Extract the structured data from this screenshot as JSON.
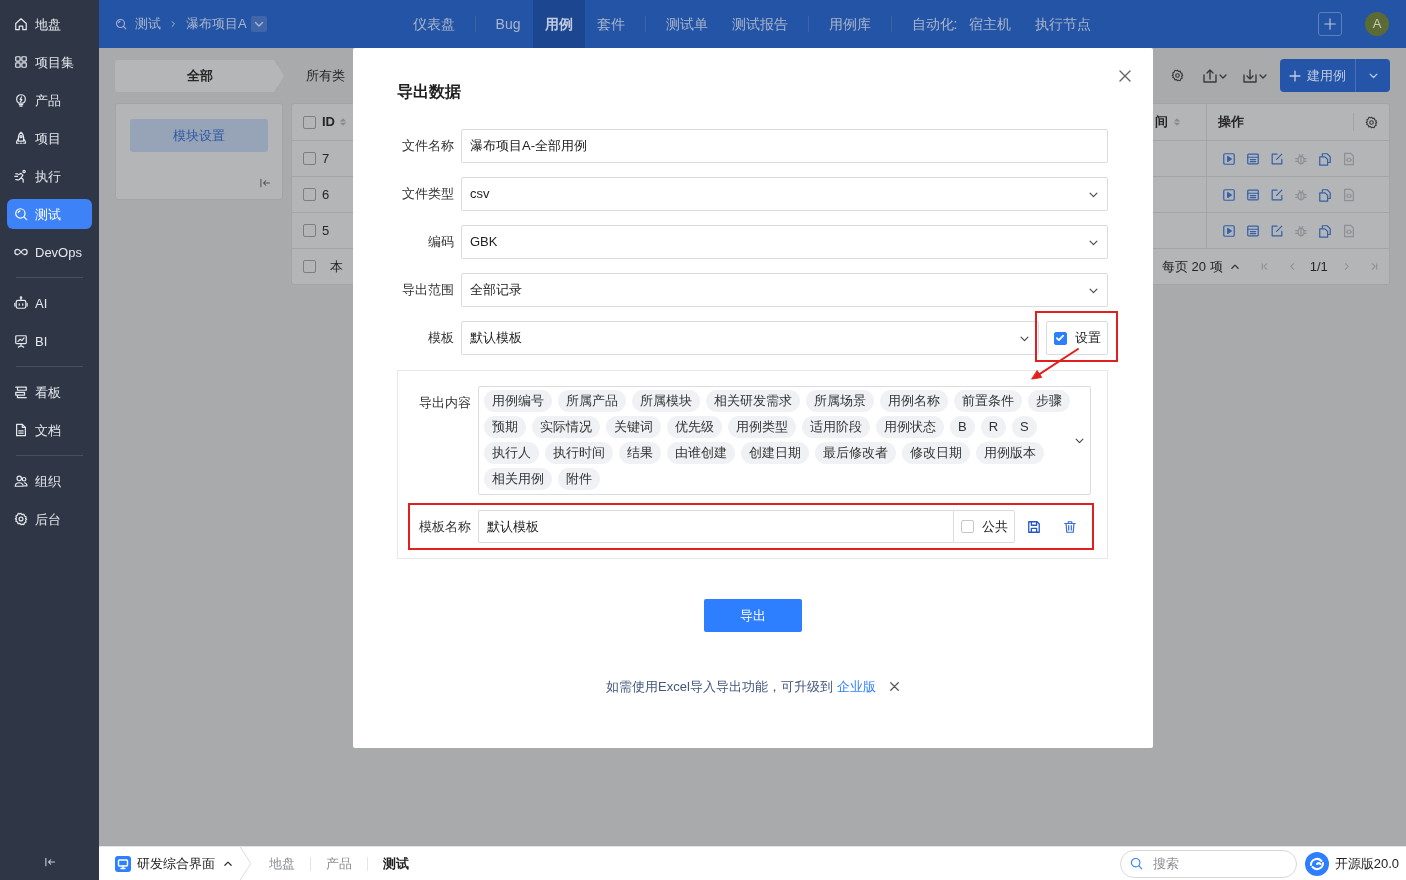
{
  "sidebar": {
    "groups": [
      {
        "items": [
          {
            "label": "地盘",
            "selected": false
          },
          {
            "label": "项目集",
            "selected": false
          },
          {
            "label": "产品",
            "selected": false
          },
          {
            "label": "项目",
            "selected": false
          },
          {
            "label": "执行",
            "selected": false
          },
          {
            "label": "测试",
            "selected": true
          },
          {
            "label": "DevOps",
            "selected": false
          }
        ]
      },
      {
        "items": [
          {
            "label": "AI",
            "selected": false
          },
          {
            "label": "BI",
            "selected": false
          }
        ]
      },
      {
        "items": [
          {
            "label": "看板",
            "selected": false
          },
          {
            "label": "文档",
            "selected": false
          }
        ]
      },
      {
        "items": [
          {
            "label": "组织",
            "selected": false
          },
          {
            "label": "后台",
            "selected": false
          }
        ]
      }
    ]
  },
  "top_bar": {
    "module": "测试",
    "project": "瀑布项目A",
    "menu": [
      {
        "items": [
          {
            "label": "仪表盘",
            "selected": false
          }
        ]
      },
      {
        "items": [
          {
            "label": "Bug",
            "selected": false
          },
          {
            "label": "用例",
            "selected": true
          },
          {
            "label": "套件",
            "selected": false
          }
        ]
      },
      {
        "items": [
          {
            "label": "测试单",
            "selected": false
          },
          {
            "label": "测试报告",
            "selected": false
          }
        ]
      },
      {
        "items": [
          {
            "label": "用例库",
            "selected": false
          }
        ]
      },
      {
        "label": "自动化:",
        "items": [
          {
            "label": "宿主机",
            "selected": false
          },
          {
            "label": "执行节点",
            "selected": false
          }
        ]
      }
    ],
    "avatar": "A"
  },
  "filter_bar": {
    "tabs": [
      {
        "label": "全部",
        "selected": true
      },
      {
        "label": "所有类",
        "selected": false
      }
    ]
  },
  "module_panel": {
    "button": "模块设置"
  },
  "toolbar": {
    "create_button": "建用例"
  },
  "table": {
    "checked": false,
    "columns": {
      "id": "ID",
      "time": "间",
      "actions": "操作"
    },
    "rows": [
      {
        "id": "7",
        "checked": false,
        "actions": [
          {
            "disabled": false
          },
          {
            "disabled": false
          },
          {
            "disabled": false
          },
          {
            "disabled": true
          },
          {
            "disabled": false
          },
          {
            "disabled": true
          }
        ]
      },
      {
        "id": "6",
        "checked": false,
        "actions": [
          {
            "disabled": false
          },
          {
            "disabled": false
          },
          {
            "disabled": false
          },
          {
            "disabled": true
          },
          {
            "disabled": false
          },
          {
            "disabled": true
          }
        ]
      },
      {
        "id": "5",
        "checked": false,
        "actions": [
          {
            "disabled": false
          },
          {
            "disabled": false
          },
          {
            "disabled": false
          },
          {
            "disabled": true
          },
          {
            "disabled": false
          },
          {
            "disabled": true
          }
        ]
      }
    ],
    "footer": {
      "checked": false,
      "label": "本",
      "page_size": "每页 20 项",
      "page": "1/1"
    }
  },
  "dialog": {
    "title": "导出数据",
    "fields": [
      {
        "kind": "text",
        "label": "文件名称",
        "value": "瀑布项目A-全部用例"
      },
      {
        "kind": "select",
        "label": "文件类型",
        "value": "csv"
      },
      {
        "kind": "select",
        "label": "编码",
        "value": "GBK"
      },
      {
        "kind": "select",
        "label": "导出范围",
        "value": "全部记录"
      },
      {
        "kind": "template",
        "label": "模板",
        "value": "默认模板",
        "option": {
          "label": "设置",
          "checked": true
        }
      }
    ],
    "content": {
      "label": "导出内容",
      "tags": [
        "用例编号",
        "所属产品",
        "所属模块",
        "相关研发需求",
        "所属场景",
        "用例名称",
        "前置条件",
        "步骤",
        "预期",
        "实际情况",
        "关键词",
        "优先级",
        "用例类型",
        "适用阶段",
        "用例状态",
        "B",
        "R",
        "S",
        "执行人",
        "执行时间",
        "结果",
        "由谁创建",
        "创建日期",
        "最后修改者",
        "修改日期",
        "用例版本",
        "相关用例",
        "附件"
      ]
    },
    "template_name": {
      "label": "模板名称",
      "value": "默认模板",
      "option": {
        "label": "公共",
        "checked": false
      }
    },
    "submit": "导出",
    "notice": {
      "text": "如需使用Excel导入导出功能，可升级到",
      "link": "企业版"
    }
  },
  "status_bar": {
    "app": "研发综合界面",
    "breadcrumb": [
      {
        "label": "地盘",
        "selected": false
      },
      {
        "label": "产品",
        "selected": false
      },
      {
        "label": "测试",
        "selected": true
      }
    ],
    "search": {
      "placeholder": "搜索"
    },
    "version": "开源版20.0"
  }
}
